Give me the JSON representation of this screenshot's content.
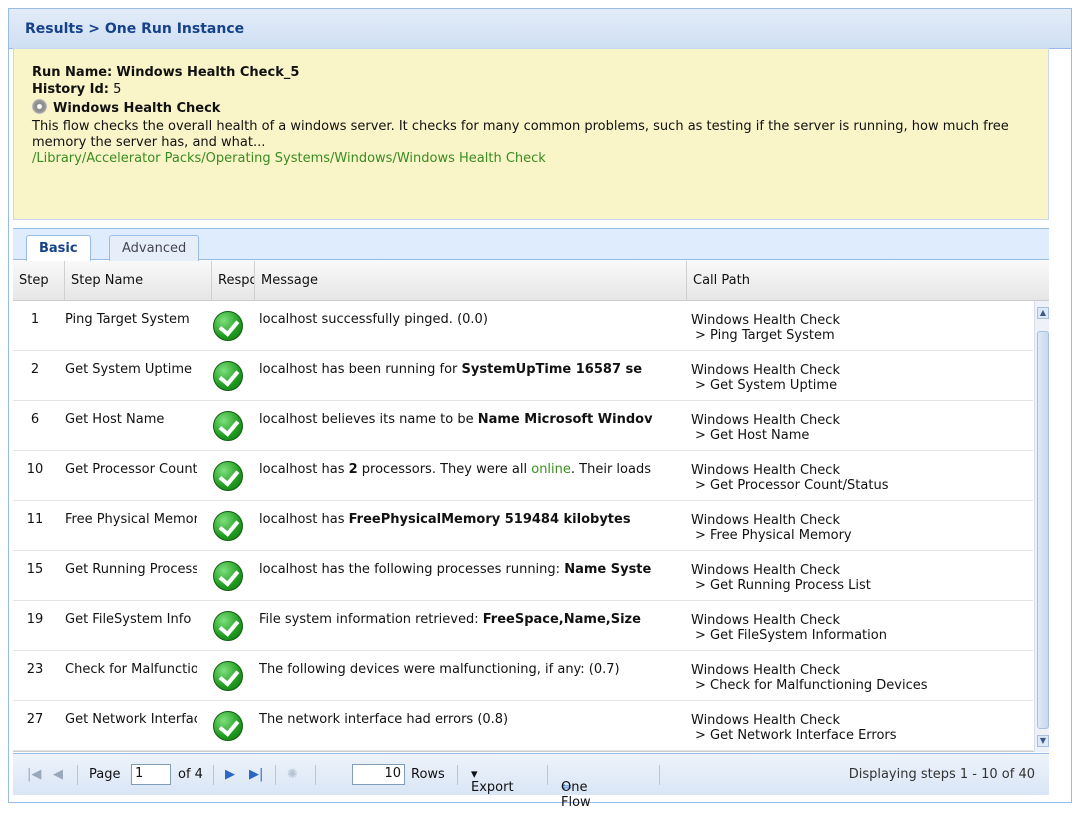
{
  "breadcrumb": "Results > One Run Instance",
  "run": {
    "name_label": "Run Name:",
    "name_value": "Windows Health Check_5",
    "history_label": "History Id:",
    "history_value": "5",
    "flow_title": "Windows Health Check",
    "description": "This flow checks the overall health of a windows server. It checks for many common problems, such as testing if the server is running, how much free memory the server has, and what...",
    "path": "/Library/Accelerator Packs/Operating Systems/Windows/Windows Health Check"
  },
  "tabs": [
    "Basic",
    "Advanced"
  ],
  "columns": [
    "Step",
    "Step Name",
    "Respo",
    "Message",
    "Call Path"
  ],
  "rows": [
    {
      "step": "1",
      "name": "Ping Target System",
      "msg_pre": "localhost successfully pinged. (0.0)",
      "msg_bold": "",
      "msg_post": "",
      "call": "Windows Health Check",
      "sub": "> Ping Target System"
    },
    {
      "step": "2",
      "name": "Get System Uptime",
      "msg_pre": "localhost has been running for ",
      "msg_bold": "SystemUpTime 16587 se",
      "msg_post": "",
      "call": "Windows Health Check",
      "sub": "> Get System Uptime"
    },
    {
      "step": "6",
      "name": "Get Host Name",
      "msg_pre": "localhost believes its name to be ",
      "msg_bold": "Name Microsoft Windov",
      "msg_post": "",
      "call": "Windows Health Check",
      "sub": "> Get Host Name"
    },
    {
      "step": "10",
      "name": "Get Processor Count",
      "msg_pre": "localhost has ",
      "msg_bold": "2",
      "msg_post": " processors. They were all ",
      "msg_green": "online",
      "msg_post2": ". Their loads",
      "call": "Windows Health Check",
      "sub": "> Get Processor Count/Status"
    },
    {
      "step": "11",
      "name": "Free Physical Memory",
      "msg_pre": "localhost has ",
      "msg_bold": "FreePhysicalMemory 519484 kilobytes",
      "msg_post": "",
      "call": "Windows Health Check",
      "sub": "> Free Physical Memory"
    },
    {
      "step": "15",
      "name": "Get Running Processes",
      "msg_pre": "localhost has the following processes running: ",
      "msg_bold": "Name Syste",
      "msg_post": "",
      "call": "Windows Health Check",
      "sub": "> Get Running Process List"
    },
    {
      "step": "19",
      "name": "Get FileSystem Info",
      "msg_pre": "File system information retrieved: ",
      "msg_bold": "FreeSpace,Name,Size",
      "msg_post": "",
      "call": "Windows Health Check",
      "sub": "> Get FileSystem Information"
    },
    {
      "step": "23",
      "name": "Check for Malfunctioning",
      "msg_pre": "The following devices were malfunctioning, if any: (0.7)",
      "msg_bold": "",
      "msg_post": "",
      "call": "Windows Health Check",
      "sub": "> Check for Malfunctioning Devices"
    },
    {
      "step": "27",
      "name": "Get Network Interface",
      "msg_pre": "The network interface had errors (0.8)",
      "msg_bold": "",
      "msg_post": "",
      "call": "Windows Health Check",
      "sub": "> Get Network Interface Errors"
    }
  ],
  "pager": {
    "page_label": "Page",
    "page_value": "1",
    "of_label": "of 4",
    "rows_value": "10",
    "rows_label": "Rows",
    "export_label": "Export",
    "one_flow_label": "One Flow",
    "status": "Displaying steps 1 - 10 of 40"
  },
  "icons": {
    "status": "green-check-icon",
    "flow": "gear-icon"
  }
}
